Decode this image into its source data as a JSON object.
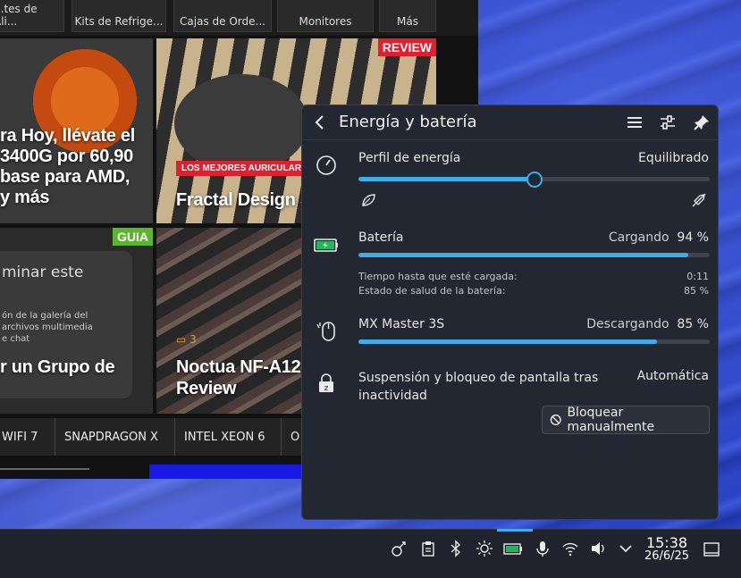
{
  "website": {
    "nav_tabs": [
      "...tes de Ali...",
      "Kits de Refrige...",
      "Cajas de Orde...",
      "Monitores",
      "Más"
    ],
    "cards": [
      {
        "title_lines": [
          "ra Hoy, llévate el",
          "3400G por 60,90",
          "base para AMD,",
          "y más"
        ]
      },
      {
        "badge": "REVIEW",
        "kicker": "LOS MEJORES AURICULARES",
        "title_lines": [
          "Fractal Design Sc"
        ]
      },
      {
        "badge": "GUIA",
        "overlay_lines": [
          "minar este",
          "ón de la galería del",
          "archivos multimedia",
          "e chat"
        ],
        "title_lines": [
          "r un Grupo de"
        ]
      },
      {
        "comments": "3",
        "title_lines": [
          "Noctua NF-A12x",
          "Review"
        ]
      }
    ],
    "tags": [
      "WIFI 7",
      "SNAPDRAGON X",
      "INTEL XEON 6",
      "O"
    ]
  },
  "panel": {
    "title": "Energía y batería",
    "energy_profile": {
      "label": "Perfil de energía",
      "value": "Equilibrado",
      "level": 0.5
    },
    "battery": {
      "label": "Batería",
      "status": "Cargando",
      "percent": "94 %",
      "level": 0.94,
      "detail_labels": [
        "Tiempo hasta que esté cargada:",
        "Estado de salud de la batería:"
      ],
      "detail_values": [
        "0:11",
        "85 %"
      ]
    },
    "mouse": {
      "label": "MX Master 3S",
      "status": "Descargando",
      "percent": "85 %",
      "level": 0.85
    },
    "suspend": {
      "label_line1": "Suspensión y bloqueo de pantalla tras",
      "label_line2": "inactividad",
      "value": "Automática",
      "button": "Bloquear manualmente"
    }
  },
  "taskbar": {
    "time": "15:38",
    "date": "26/6/25"
  },
  "colors": {
    "accent": "#3daee9",
    "panel_bg": "#232731",
    "review_badge": "#e01f2f",
    "guia_badge": "#5cb531"
  }
}
